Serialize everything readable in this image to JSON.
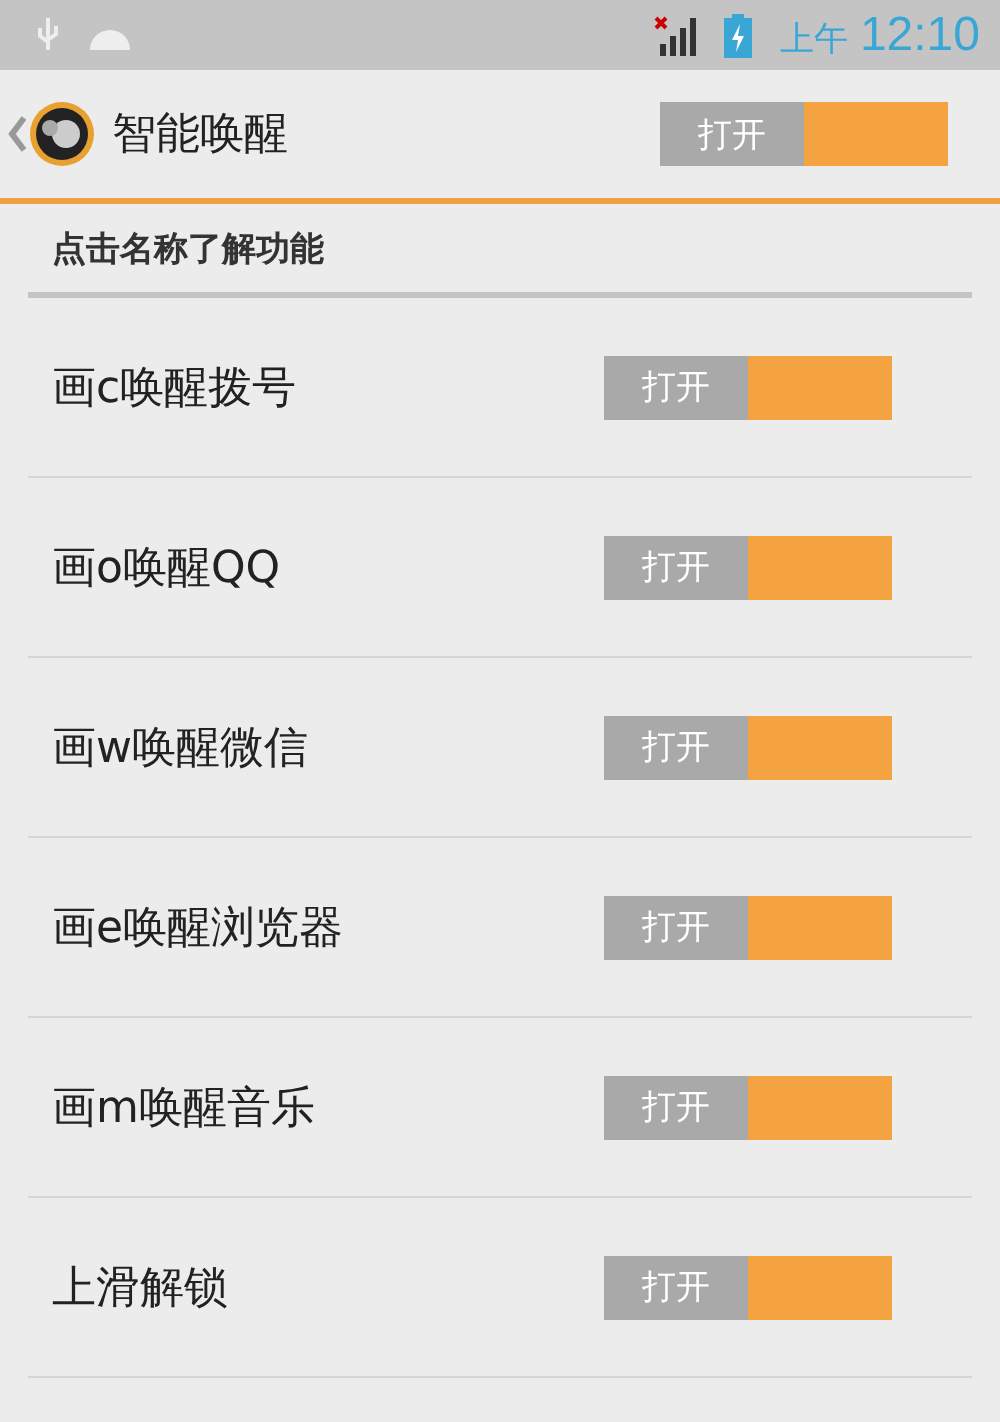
{
  "status_bar": {
    "period": "上午",
    "time": "12:10"
  },
  "header": {
    "title": "智能唤醒",
    "switch": {
      "label": "打开",
      "on": true
    }
  },
  "section_title": "点击名称了解功能",
  "items": [
    {
      "label": "画c唤醒拨号",
      "switch": {
        "label": "打开",
        "on": true
      }
    },
    {
      "label": "画o唤醒QQ",
      "switch": {
        "label": "打开",
        "on": true
      }
    },
    {
      "label": "画w唤醒微信",
      "switch": {
        "label": "打开",
        "on": true
      }
    },
    {
      "label": "画e唤醒浏览器",
      "switch": {
        "label": "打开",
        "on": true
      }
    },
    {
      "label": "画m唤醒音乐",
      "switch": {
        "label": "打开",
        "on": true
      }
    },
    {
      "label": "上滑解锁",
      "switch": {
        "label": "打开",
        "on": true
      }
    }
  ]
}
